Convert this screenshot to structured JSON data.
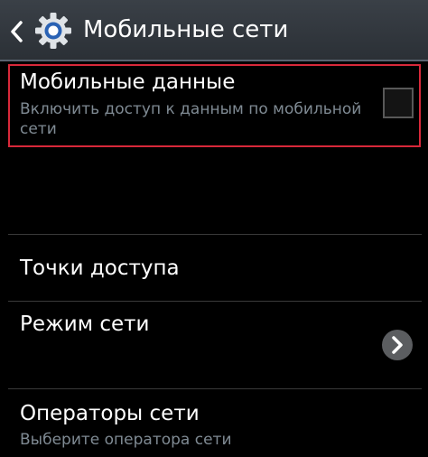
{
  "header": {
    "title": "Мобильные сети",
    "back_icon": "back-chevron-icon",
    "settings_icon": "gear-icon"
  },
  "settings": {
    "mobile_data": {
      "title": "Мобильные данные",
      "subtitle": "Включить доступ к данным по мобильной сети",
      "checked": false
    },
    "access_points": {
      "title": "Точки доступа"
    },
    "network_mode": {
      "title": "Режим сети"
    },
    "network_operators": {
      "title": "Операторы сети",
      "subtitle": "Выберите оператора сети"
    }
  },
  "colors": {
    "background": "#000000",
    "header": "#32383f",
    "highlight": "#d8283a",
    "subtitle": "#7f8a93"
  }
}
